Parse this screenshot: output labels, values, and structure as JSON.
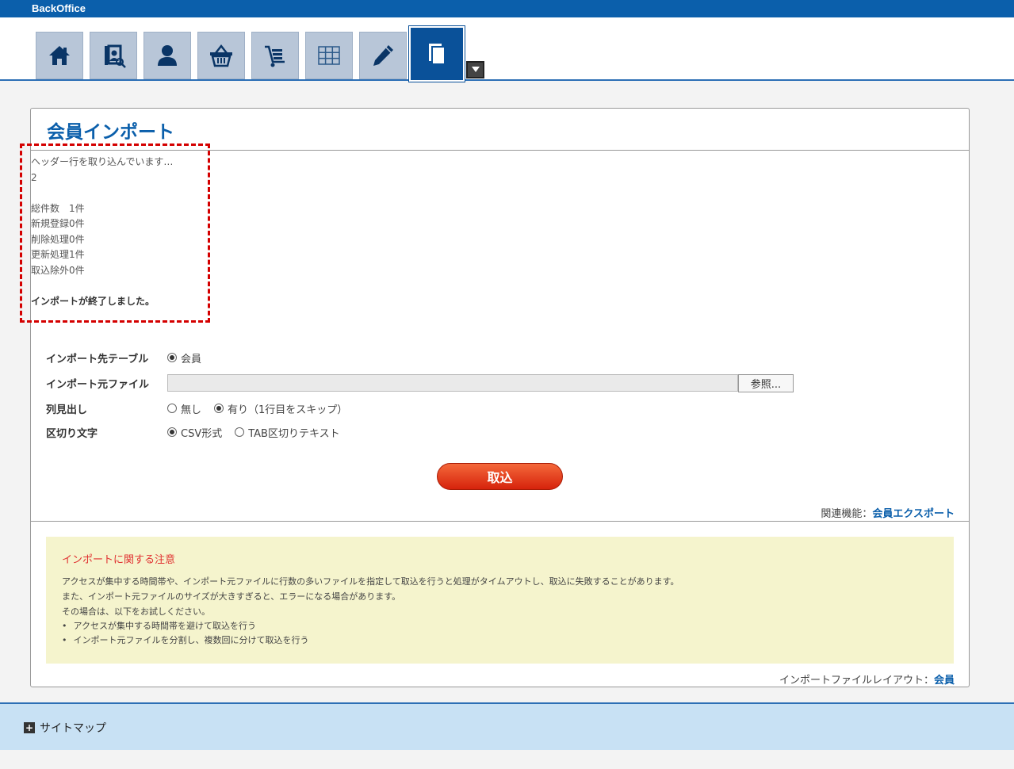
{
  "app": {
    "brand": "BackOffice"
  },
  "nav": {
    "items": [
      {
        "icon": "home-icon"
      },
      {
        "icon": "member-search-icon"
      },
      {
        "icon": "user-icon"
      },
      {
        "icon": "basket-icon"
      },
      {
        "icon": "cart-icon"
      },
      {
        "icon": "grid-icon"
      },
      {
        "icon": "pencil-icon"
      },
      {
        "icon": "pages-icon",
        "active": true
      }
    ],
    "more_icon": "dropdown-arrow-icon"
  },
  "page": {
    "title": "会員インポート"
  },
  "log": {
    "status": "ヘッダー行を取り込んでいます…",
    "line_no": "2",
    "total": "総件数　1件",
    "new": "新規登録0件",
    "deleted": "削除処理0件",
    "updated": "更新処理1件",
    "excluded": "取込除外0件",
    "done": "インポートが終了しました。"
  },
  "form": {
    "target_table_label": "インポート先テーブル",
    "target_table_value": "会員",
    "source_file_label": "インポート元ファイル",
    "source_file_value": "",
    "browse_label": "参照...",
    "header_label": "列見出し",
    "header_none": "無し",
    "header_yes": "有り（1行目をスキップ）",
    "header_selected": "yes",
    "delimiter_label": "区切り文字",
    "delim_csv": "CSV形式",
    "delim_tab": "TAB区切りテキスト",
    "delimiter_selected": "csv",
    "import_button": "取込"
  },
  "related": {
    "label": "関連機能：",
    "link": "会員エクスポート"
  },
  "notes": {
    "title": "インポートに関する注意",
    "lines": [
      "アクセスが集中する時間帯や、インポート元ファイルに行数の多いファイルを指定して取込を行うと処理がタイムアウトし、取込に失敗することがあります。",
      "また、インポート元ファイルのサイズが大きすぎると、エラーになる場合があります。",
      "その場合は、以下をお試しください。"
    ],
    "bullets": [
      "アクセスが集中する時間帯を避けて取込を行う",
      "インポート元ファイルを分割し、複数回に分けて取込を行う"
    ]
  },
  "layout_ref": {
    "label": "インポートファイルレイアウト：",
    "link": "会員"
  },
  "footer": {
    "sitemap": "サイトマップ"
  }
}
